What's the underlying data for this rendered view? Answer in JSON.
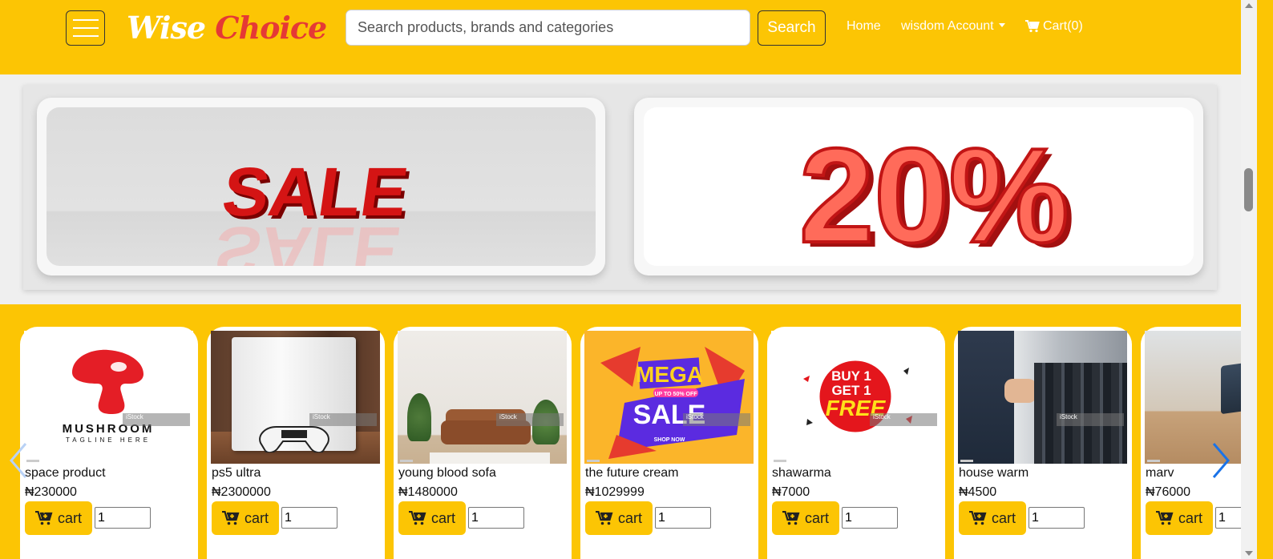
{
  "brand": {
    "word1": "Wise",
    "word2": "Choice"
  },
  "search": {
    "placeholder": "Search products, brands and categories",
    "button_label": "Search"
  },
  "nav": {
    "home": "Home",
    "account": "wisdom Account",
    "cart": "Cart(0)"
  },
  "banners": {
    "slide1_text": "SALE",
    "slide2_text": "20%"
  },
  "products": [
    {
      "name": "space product",
      "price": "₦230000",
      "qty": "1",
      "image_text": "MUSHROOM",
      "image_sub": "TAGLINE HERE"
    },
    {
      "name": "ps5 ultra",
      "price": "₦2300000",
      "qty": "1"
    },
    {
      "name": "young blood sofa",
      "price": "₦1480000",
      "qty": "1"
    },
    {
      "name": "the future cream",
      "price": "₦1029999",
      "qty": "1",
      "image_text": "MEGA",
      "image_text2": "SALE",
      "image_sub": "UP TO 50% OFF",
      "image_sub2": "SHOP NOW"
    },
    {
      "name": "shawarma",
      "price": "₦7000",
      "qty": "1",
      "image_text": "BUY 1",
      "image_text2": "GET 1",
      "image_text3": "FREE"
    },
    {
      "name": "house warm",
      "price": "₦4500",
      "qty": "1"
    },
    {
      "name": "marv",
      "price": "₦76000",
      "qty": "1"
    }
  ],
  "cart_button_label": "cart",
  "watermark_text": "iStock",
  "colors": {
    "accent": "#fcc504",
    "brand_red": "#e53935",
    "arrow_blue": "#1a73e8"
  }
}
